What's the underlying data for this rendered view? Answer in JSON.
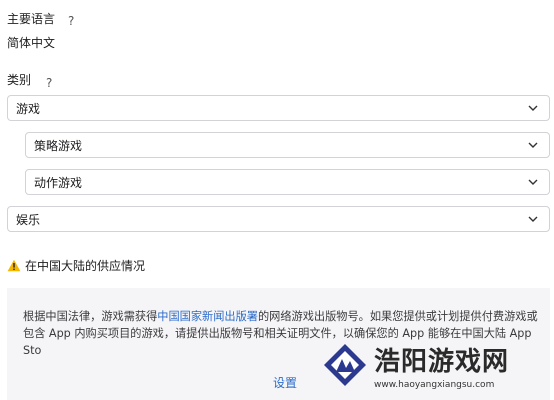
{
  "primary_language": {
    "label": "主要语言",
    "help": "?",
    "value": "简体中文"
  },
  "category": {
    "label": "类别",
    "help": "?",
    "primary": "游戏",
    "sub1": "策略游戏",
    "sub2": "动作游戏",
    "secondary": "娱乐"
  },
  "availability": {
    "title": "在中国大陆的供应情况",
    "notice_part1": "根据中国法律，游戏需获得",
    "notice_link": "中国国家新闻出版署",
    "notice_part2": "的网络游戏出版物号。如果您提供或计划提供付费游戏或包含 App 内购买项目的游戏，请提供出版物号和相关证明文件，以确保您的 App 能够在中国大陆 App Sto",
    "settings_label": "设置"
  },
  "watermark": {
    "title": "浩阳游戏网",
    "url": "www.haoyangxiangsu.com"
  },
  "colors": {
    "accent": "#2c6bc9",
    "warning": "#f5b800",
    "panel_bg": "#f5f5f7",
    "border": "#d2d2d7"
  }
}
